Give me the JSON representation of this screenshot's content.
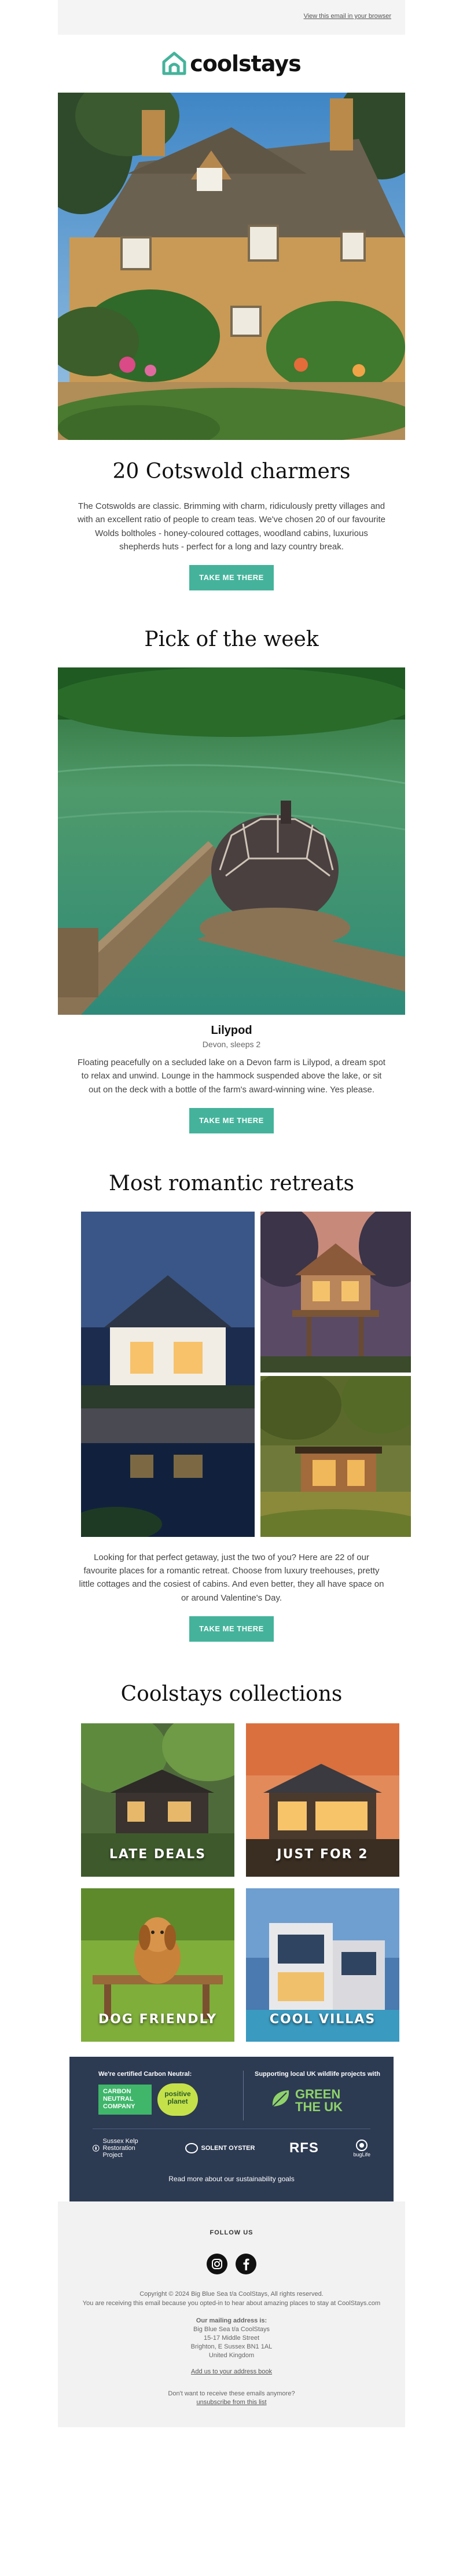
{
  "topbar": {
    "view_in_browser": "View this email in your browser"
  },
  "brand": {
    "name": "coolstays",
    "accent": "#45b39b",
    "navy": "#2c3a52"
  },
  "feature": {
    "title": "20 Cotswold charmers",
    "body": "The Cotswolds are classic. Brimming with charm, ridiculously pretty villages and with an excellent ratio of people to cream teas. We've chosen 20 of our favourite Wolds boltholes - honey-coloured cottages, woodland cabins, luxurious shepherds huts - perfect for a long and lazy country break.",
    "cta": "TAKE ME THERE"
  },
  "pick": {
    "heading": "Pick of the week",
    "property_name": "Lilypod",
    "property_location": "Devon, sleeps 2",
    "body": "Floating peacefully on a secluded lake on a Devon farm is Lilypod, a dream spot to relax and unwind. Lounge in the hammock suspended above the lake, or sit out on the deck with a bottle of the farm's award-winning wine. Yes please.",
    "cta": "TAKE ME THERE"
  },
  "romantic": {
    "heading": "Most romantic retreats",
    "body": "Looking for that perfect getaway, just the two of you? Here are 22 of our favourite places for a romantic retreat. Choose from luxury treehouses, pretty little cottages and the cosiest of cabins. And even better, they all have space on or around Valentine's Day.",
    "cta": "TAKE ME THERE"
  },
  "collections": {
    "heading": "Coolstays collections",
    "items": [
      {
        "label": "LATE DEALS"
      },
      {
        "label": "JUST FOR 2"
      },
      {
        "label": "DOG FRIENDLY"
      },
      {
        "label": "COOL VILLAS"
      }
    ]
  },
  "sustainability": {
    "left_title": "We're certified Carbon Neutral:",
    "carbon_badge_line1": "CARBON",
    "carbon_badge_line2": "NEUTRAL",
    "carbon_badge_line3": "COMPANY",
    "positive_planet_1": "positive",
    "positive_planet_2": "planet",
    "right_title": "Supporting local UK wildlife projects with",
    "green_uk_1": "GREEN",
    "green_uk_2": "THE UK",
    "partners": [
      "Sussex Kelp Restoration Project",
      "SOLENT OYSTER",
      "RFS",
      "bugLife"
    ],
    "link": "Read more about our sustainability goals"
  },
  "footer": {
    "follow": "FOLLOW US",
    "copyright": "Copyright © 2024 Big Blue Sea t/a CoolStays, All rights reserved.",
    "reason": "You are receiving this email because you opted-in to hear about amazing places to stay at CoolStays.com",
    "address_title": "Our mailing address is:",
    "address_lines": [
      "Big Blue Sea t/a CoolStays",
      "15-17 Middle Street",
      "Brighton, E Sussex BN1 1AL",
      "United Kingdom"
    ],
    "add_address": "Add us to your address book",
    "dont_want": "Don't want to receive these emails anymore?",
    "unsubscribe": "unsubscribe from this list"
  }
}
